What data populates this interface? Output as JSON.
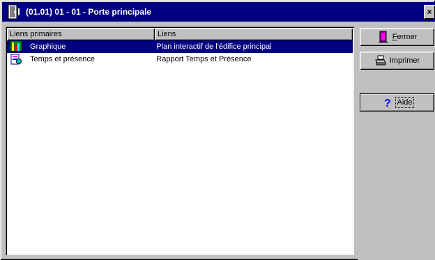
{
  "window": {
    "title": "(01.01) 01 - 01 - Porte principale",
    "close_glyph": "×"
  },
  "list": {
    "columns": [
      "Liens primaires",
      "Liens"
    ],
    "rows": [
      {
        "name": "Graphique",
        "link": "Plan interactif de l'édifice principal",
        "icon": "graphic-icon",
        "selected": true
      },
      {
        "name": "Temps et présence",
        "link": "Rapport Temps et Présence",
        "icon": "report-icon",
        "selected": false
      }
    ]
  },
  "buttons": {
    "close_label": "Fermer",
    "print_label": "Imprimer",
    "help_label": "Aide"
  },
  "colors": {
    "titlebar": "#000080",
    "selection": "#000080",
    "face": "#c0c0c0"
  }
}
